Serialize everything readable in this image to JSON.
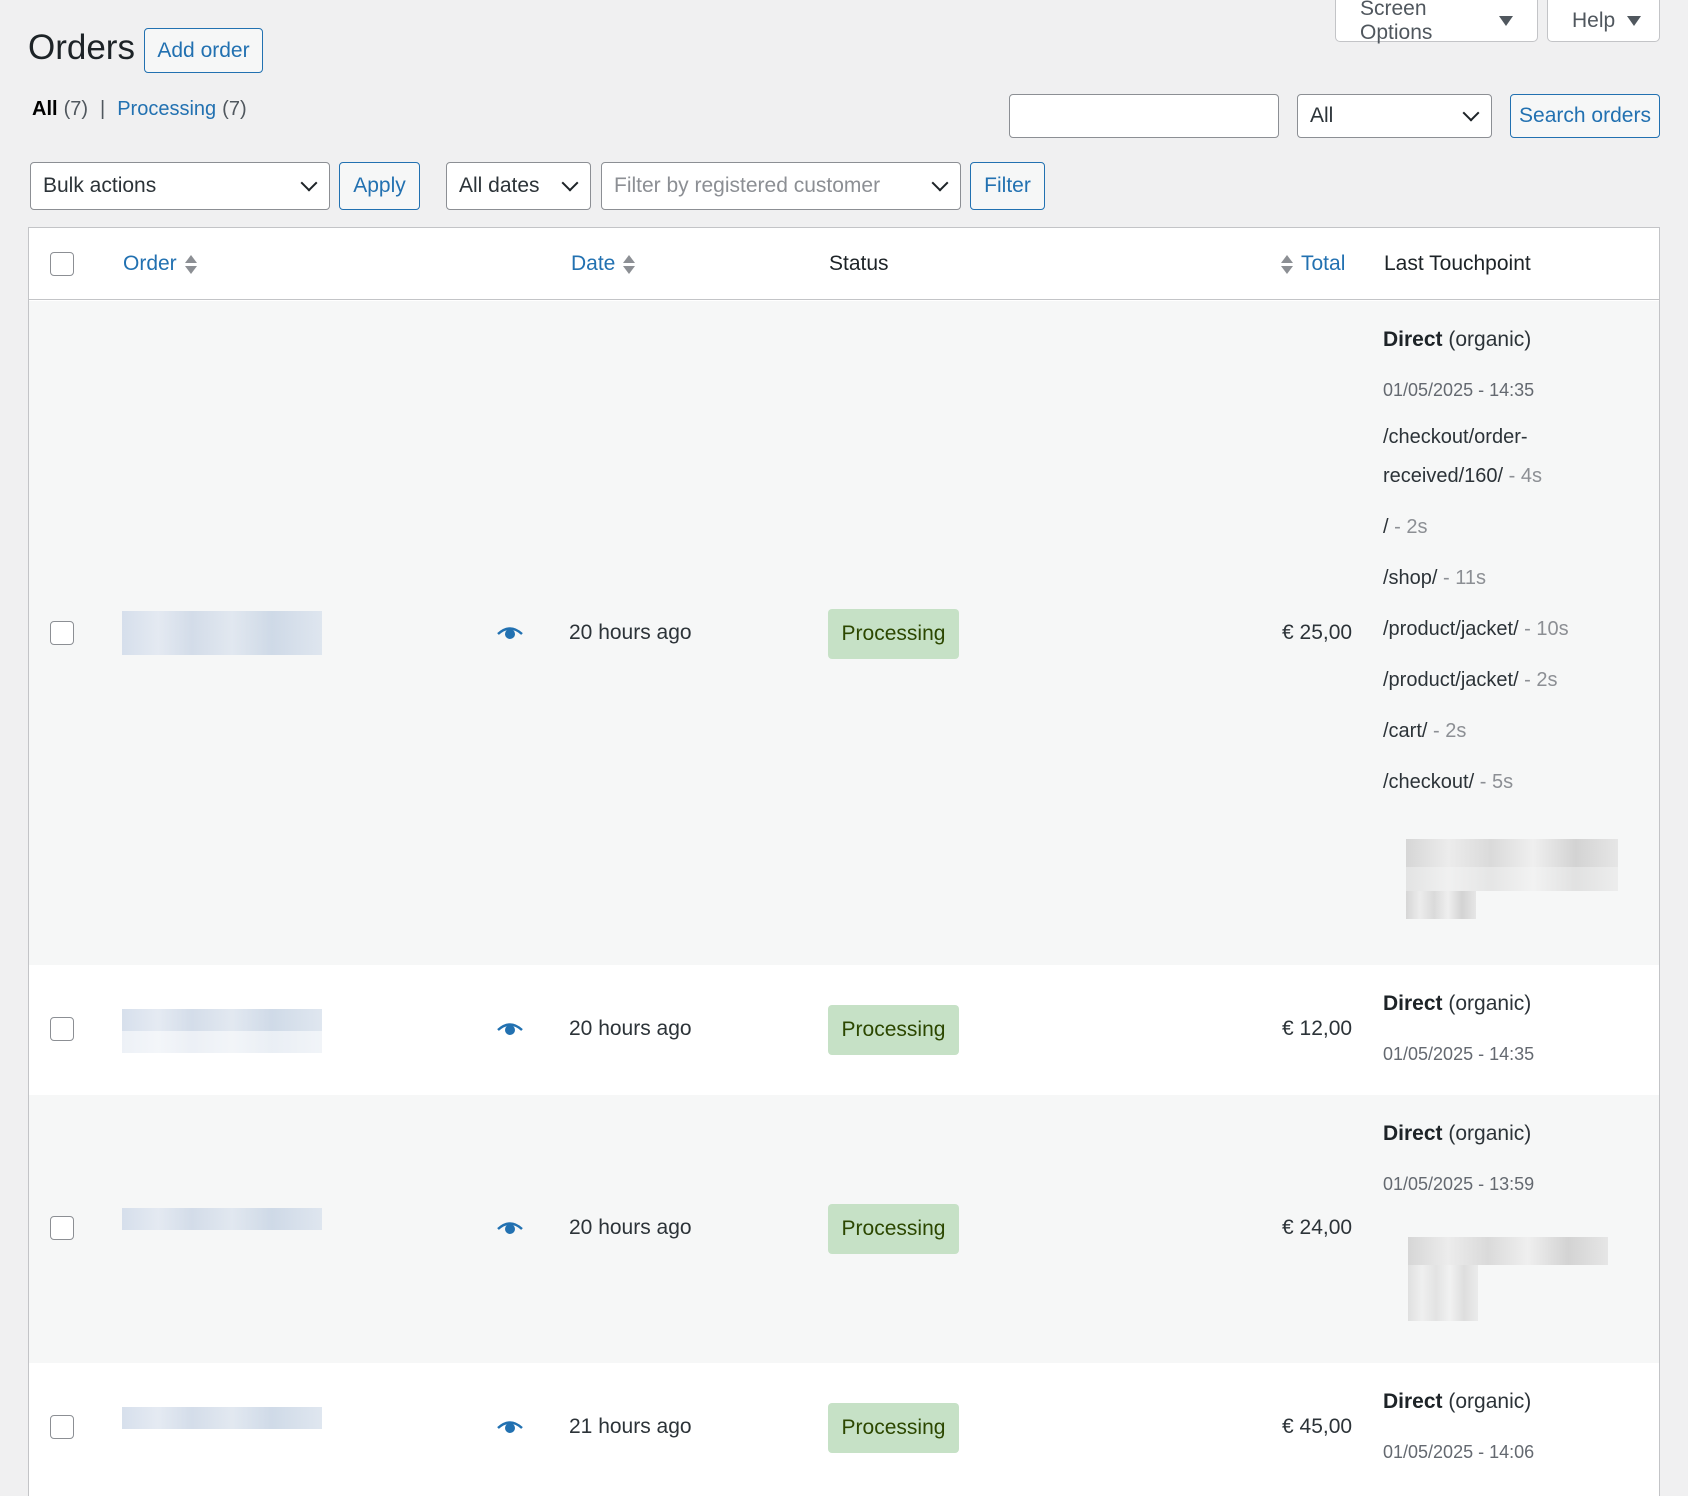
{
  "header": {
    "screen_options": "Screen Options",
    "help": "Help",
    "title": "Orders",
    "add_order": "Add order"
  },
  "views": {
    "all_label": "All",
    "all_count": "(7)",
    "separator": "|",
    "processing_label": "Processing",
    "processing_count": "(7)"
  },
  "search": {
    "value": "",
    "type_select": "All",
    "button": "Search orders"
  },
  "filters": {
    "bulk_actions": "Bulk actions",
    "apply": "Apply",
    "dates": "All dates",
    "customer_placeholder": "Filter by registered customer",
    "filter": "Filter"
  },
  "table": {
    "columns": {
      "order": "Order",
      "date": "Date",
      "status": "Status",
      "total": "Total",
      "touchpoint": "Last Touchpoint"
    },
    "rows": [
      {
        "date": "20 hours ago",
        "status": "Processing",
        "total": "€ 25,00",
        "tp_source": "Direct",
        "tp_medium": "(organic)",
        "tp_date": "01/05/2025 - 14:35",
        "paths": [
          {
            "path": "/checkout/order-",
            "dur": ""
          },
          {
            "path": "received/160/",
            "dur": " - 4s"
          },
          {
            "path": "/",
            "dur": " - 2s"
          },
          {
            "path": "/shop/",
            "dur": " - 11s"
          },
          {
            "path": "/product/jacket/",
            "dur": " - 10s"
          },
          {
            "path": "/product/jacket/",
            "dur": " - 2s"
          },
          {
            "path": "/cart/",
            "dur": " - 2s"
          },
          {
            "path": "/checkout/",
            "dur": " - 5s"
          }
        ]
      },
      {
        "date": "20 hours ago",
        "status": "Processing",
        "total": "€ 12,00",
        "tp_source": "Direct",
        "tp_medium": "(organic)",
        "tp_date": "01/05/2025 - 14:35"
      },
      {
        "date": "20 hours ago",
        "status": "Processing",
        "total": "€ 24,00",
        "tp_source": "Direct",
        "tp_medium": "(organic)",
        "tp_date": "01/05/2025 - 13:59"
      },
      {
        "date": "21 hours ago",
        "status": "Processing",
        "total": "€ 45,00",
        "tp_source": "Direct",
        "tp_medium": "(organic)",
        "tp_date": "01/05/2025 - 14:06"
      }
    ]
  },
  "colors": {
    "accent": "#2271b1",
    "status_processing_bg": "#c6e1c6",
    "status_processing_text": "#2c4700"
  }
}
